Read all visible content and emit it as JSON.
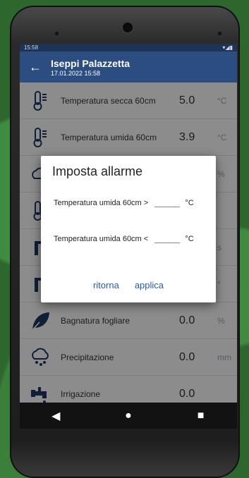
{
  "status": {
    "time": "15:58"
  },
  "appbar": {
    "title": "Iseppi Palazzetta",
    "subtitle": "17.01.2022 15:58"
  },
  "rows": [
    {
      "label": "Temperatura secca 60cm",
      "value": "5.0",
      "unit": "°C",
      "icon": "thermometer-icon"
    },
    {
      "label": "Temperatura umida 60cm",
      "value": "3.9",
      "unit": "°C",
      "icon": "thermometer-icon"
    },
    {
      "label": "",
      "value": "",
      "unit": "%",
      "icon": "cloud-icon"
    },
    {
      "label": "",
      "value": "",
      "unit": "",
      "icon": "thermometer-icon"
    },
    {
      "label": "",
      "value": "",
      "unit": "s",
      "icon": "sprinkler-icon"
    },
    {
      "label": "",
      "value": "",
      "unit": "°",
      "icon": "sprinkler-icon"
    },
    {
      "label": "Bagnatura fogliare",
      "value": "0.0",
      "unit": "%",
      "icon": "leaf-icon"
    },
    {
      "label": "Precipitazione",
      "value": "0.0",
      "unit": "mm",
      "icon": "rain-cloud-icon"
    },
    {
      "label": "Irrigazione",
      "value": "0.0",
      "unit": "",
      "icon": "faucet-icon"
    }
  ],
  "dialog": {
    "title": "Imposta allarme",
    "fields": [
      {
        "label": "Temperatura umida 60cm >",
        "unit": "°C"
      },
      {
        "label": "Temperatura umida 60cm <",
        "unit": "°C"
      }
    ],
    "buttons": {
      "cancel": "ritorna",
      "apply": "applica"
    }
  },
  "navbar": {
    "back": "◀",
    "home": "●",
    "recent": "■"
  }
}
